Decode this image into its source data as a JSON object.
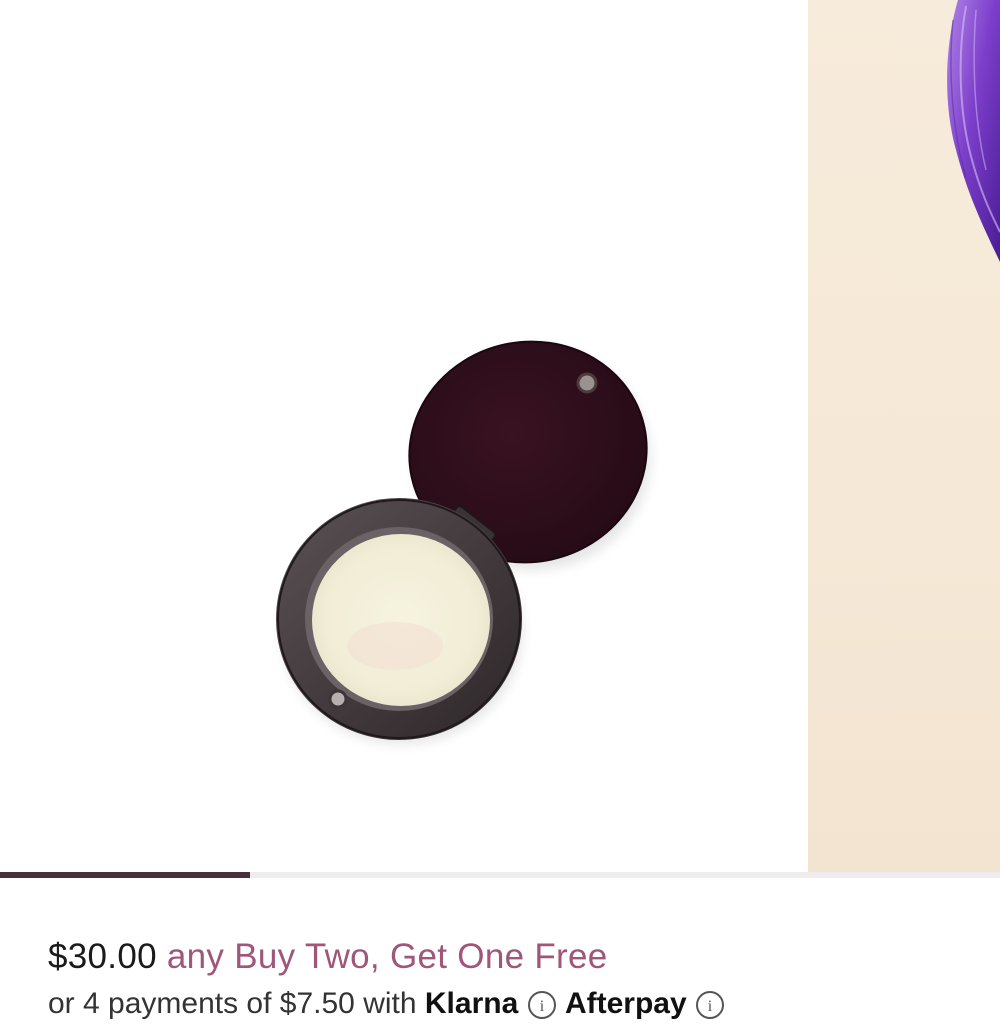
{
  "gallery": {
    "active_index": 1,
    "progress_fraction": 0.25
  },
  "product": {
    "price": "$30.00",
    "promo": "any Buy Two, Get One Free"
  },
  "installments": {
    "text_a": "or 4 payments of $7.50 with",
    "brand_a": "Klarna",
    "brand_b": "Afterpay"
  },
  "colors": {
    "progress": "#4a2e3c",
    "promo": "#a0567a",
    "compact_lid": "#3b1524",
    "compact_body": "#4b4346",
    "balm": "#f2efd9",
    "petal": "#8a4fd0",
    "beige_panel": "#f5e8d6"
  },
  "icons": [
    "info-icon",
    "info-icon"
  ]
}
